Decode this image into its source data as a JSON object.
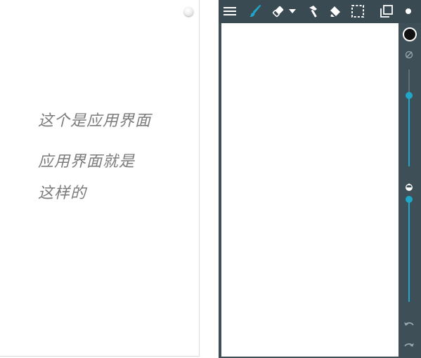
{
  "note": {
    "line1": "这个是应用界面",
    "line2": "应用界面就是",
    "line3": "这样的"
  },
  "icons": {
    "left_menu": "menu-dot-icon",
    "toolbar": [
      "hamburger-menu-icon",
      "brush-icon",
      "eraser-icon",
      "dropdown-arrow-icon",
      "hammer-icon",
      "fill-bucket-icon",
      "selection-icon",
      "layers-icon",
      "dot-icon"
    ],
    "side": [
      "color-swatch",
      "opacity-off-icon",
      "opacity-icon",
      "undo-icon",
      "redo-icon"
    ]
  },
  "sliders": {
    "size_level": 0.27,
    "opacity_level": 1.0
  },
  "colors": {
    "toolbar_bg": "#3a4a52",
    "panel_bg": "#3f4f57",
    "accent": "#1ea7c9",
    "brush_color": "#111111",
    "text_gray": "#7b7b7b"
  }
}
